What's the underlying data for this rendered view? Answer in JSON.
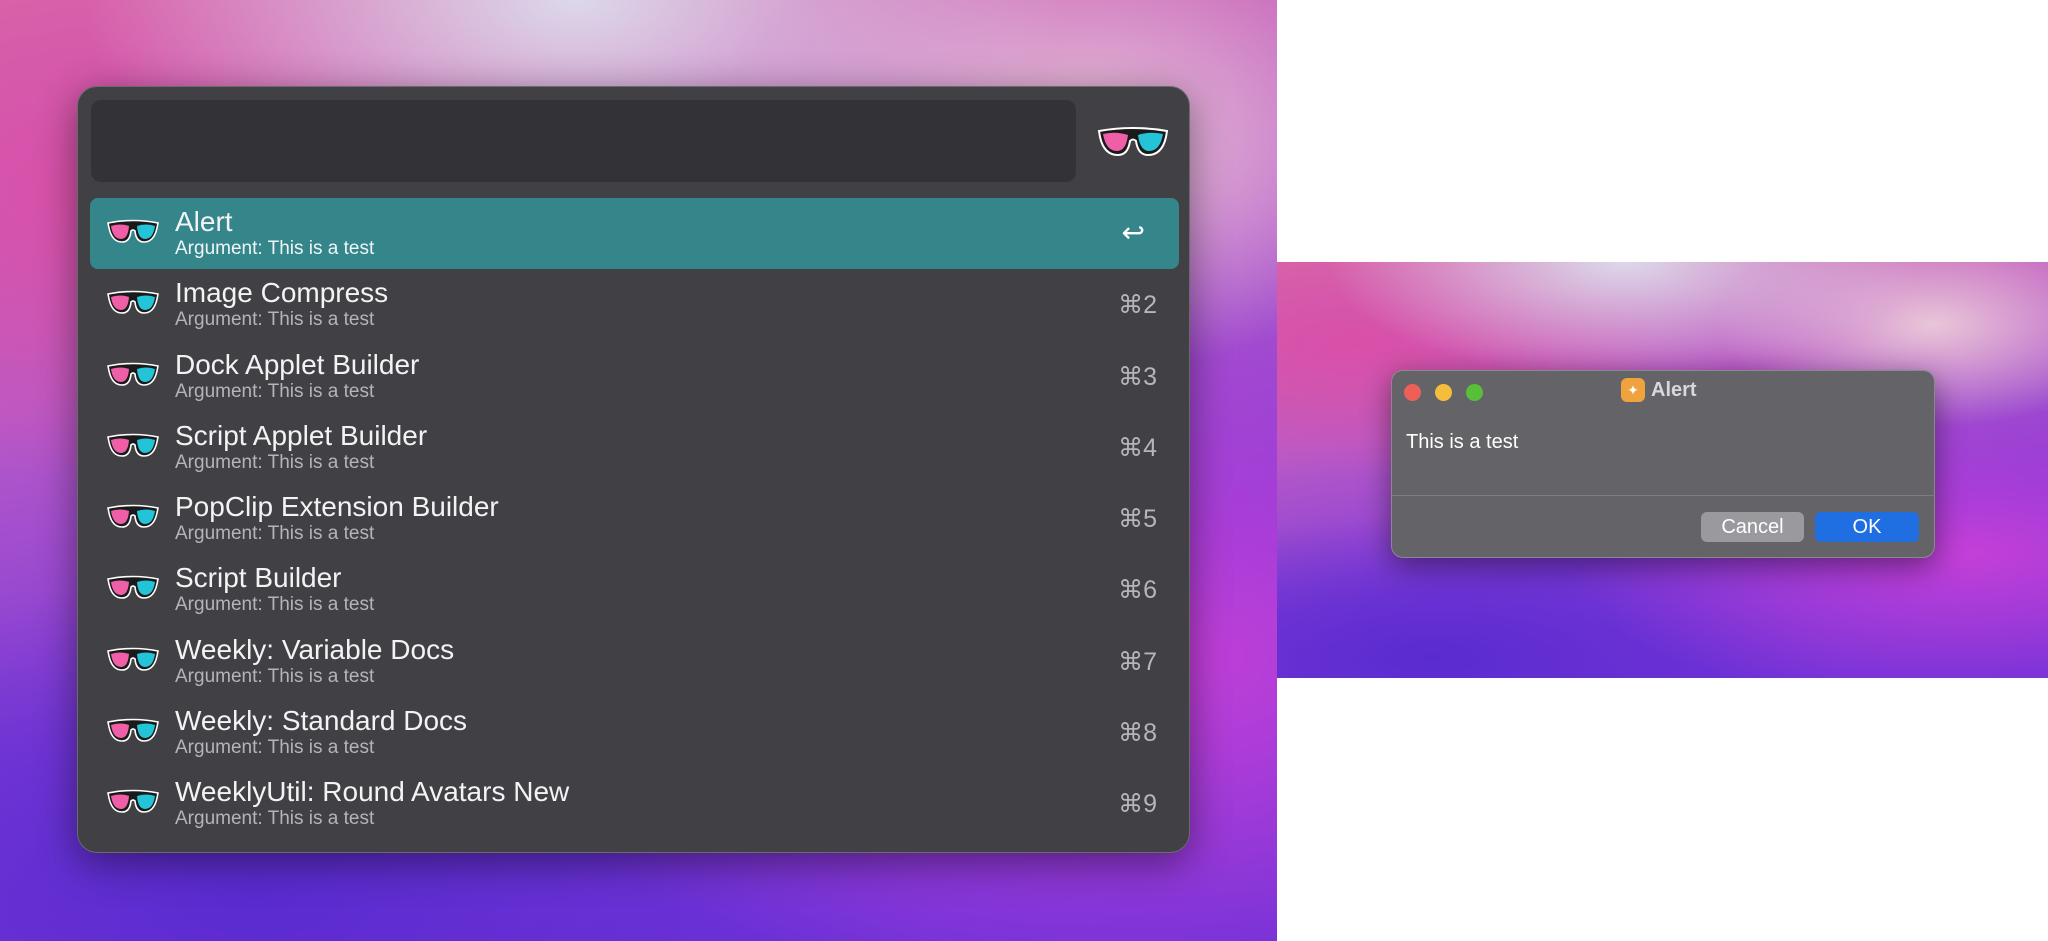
{
  "launcher": {
    "search_value": "",
    "items": [
      {
        "title": "Alert",
        "subtitle": "Argument: This is a test",
        "shortcut": "↩",
        "selected": true
      },
      {
        "title": "Image Compress",
        "subtitle": "Argument: This is a test",
        "shortcut": "⌘2"
      },
      {
        "title": "Dock Applet Builder",
        "subtitle": "Argument: This is a test",
        "shortcut": "⌘3"
      },
      {
        "title": "Script Applet Builder",
        "subtitle": "Argument: This is a test",
        "shortcut": "⌘4"
      },
      {
        "title": "PopClip Extension Builder",
        "subtitle": "Argument: This is a test",
        "shortcut": "⌘5"
      },
      {
        "title": "Script Builder",
        "subtitle": "Argument: This is a test",
        "shortcut": "⌘6"
      },
      {
        "title": "Weekly: Variable Docs",
        "subtitle": "Argument: This is a test",
        "shortcut": "⌘7"
      },
      {
        "title": "Weekly: Standard Docs",
        "subtitle": "Argument: This is a test",
        "shortcut": "⌘8"
      },
      {
        "title": "WeeklyUtil: Round Avatars New",
        "subtitle": "Argument: This is a test",
        "shortcut": "⌘9"
      }
    ],
    "item_icon": "sunglasses-icon",
    "selected_color": "#35868b"
  },
  "dialog": {
    "title": "Alert",
    "message": "This is a test",
    "cancel_label": "Cancel",
    "ok_label": "OK",
    "ok_color": "#1f6fe2"
  }
}
